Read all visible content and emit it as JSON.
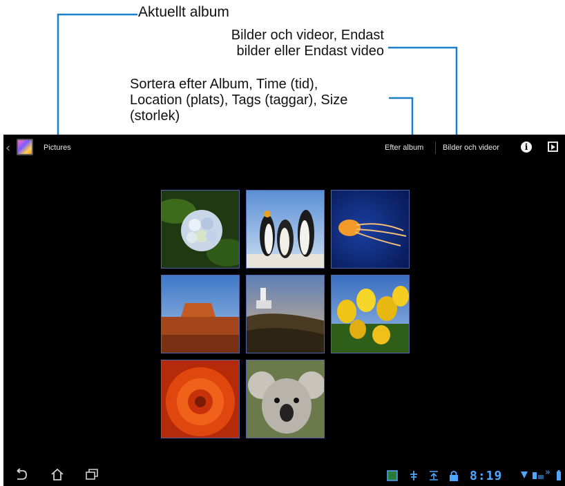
{
  "callouts": {
    "current_album": "Aktuellt album",
    "filter_line1": "Bilder och videor, Endast",
    "filter_line2": "bilder eller Endast video",
    "sort_line1": "Sortera efter Album, Time (tid),",
    "sort_line2": "Location (plats), Tags (taggar), Size",
    "sort_line3": "(storlek)"
  },
  "action_bar": {
    "album_title": "Pictures",
    "sort_label": "Efter album",
    "filter_label": "Bilder och videor",
    "info_icon": "info-icon",
    "slideshow_icon": "slideshow-icon"
  },
  "thumbnails": [
    {
      "subject": "hydrangea"
    },
    {
      "subject": "penguins"
    },
    {
      "subject": "jellyfish"
    },
    {
      "subject": "desert"
    },
    {
      "subject": "lighthouse"
    },
    {
      "subject": "tulips"
    },
    {
      "subject": "chrysanthemum"
    },
    {
      "subject": "koala"
    }
  ],
  "status_bar": {
    "clock": "8:19",
    "accent_color": "#4da6ff"
  },
  "colors": {
    "screen_bg": "#000000",
    "callout_line": "#1a7fc9",
    "thumb_border": "#5063a8"
  }
}
